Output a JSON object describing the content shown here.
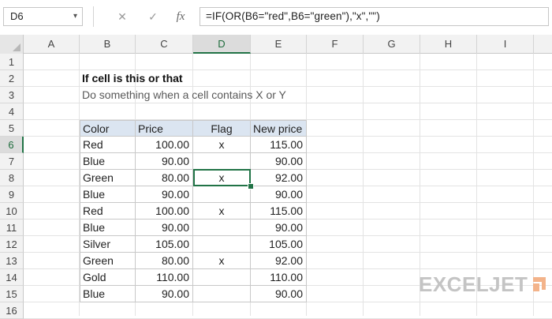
{
  "formula_bar": {
    "name_box": "D6",
    "cancel_icon": "✕",
    "enter_icon": "✓",
    "fx_label": "fx",
    "formula": "=IF(OR(B6=\"red\",B6=\"green\"),\"x\",\"\")"
  },
  "columns": [
    "A",
    "B",
    "C",
    "D",
    "E",
    "F",
    "G",
    "H",
    "I"
  ],
  "rows": [
    "1",
    "2",
    "3",
    "4",
    "5",
    "6",
    "7",
    "8",
    "9",
    "10",
    "11",
    "12",
    "13",
    "14",
    "15",
    "16"
  ],
  "active_cell": "D6",
  "sheet": {
    "title": "If cell is this or that",
    "subtitle": "Do something when a cell contains X or Y"
  },
  "table": {
    "headers": {
      "color": "Color",
      "price": "Price",
      "flag": "Flag",
      "new_price": "New price"
    },
    "rows": [
      {
        "color": "Red",
        "price": "100.00",
        "flag": "x",
        "new_price": "115.00"
      },
      {
        "color": "Blue",
        "price": "90.00",
        "flag": "",
        "new_price": "90.00"
      },
      {
        "color": "Green",
        "price": "80.00",
        "flag": "x",
        "new_price": "92.00"
      },
      {
        "color": "Blue",
        "price": "90.00",
        "flag": "",
        "new_price": "90.00"
      },
      {
        "color": "Red",
        "price": "100.00",
        "flag": "x",
        "new_price": "115.00"
      },
      {
        "color": "Blue",
        "price": "90.00",
        "flag": "",
        "new_price": "90.00"
      },
      {
        "color": "Silver",
        "price": "105.00",
        "flag": "",
        "new_price": "105.00"
      },
      {
        "color": "Green",
        "price": "80.00",
        "flag": "x",
        "new_price": "92.00"
      },
      {
        "color": "Gold",
        "price": "110.00",
        "flag": "",
        "new_price": "110.00"
      },
      {
        "color": "Blue",
        "price": "90.00",
        "flag": "",
        "new_price": "90.00"
      }
    ]
  },
  "watermark": {
    "text": "EXCELJET"
  },
  "colors": {
    "accent": "#217346",
    "table_header": "#dbe5f1"
  }
}
